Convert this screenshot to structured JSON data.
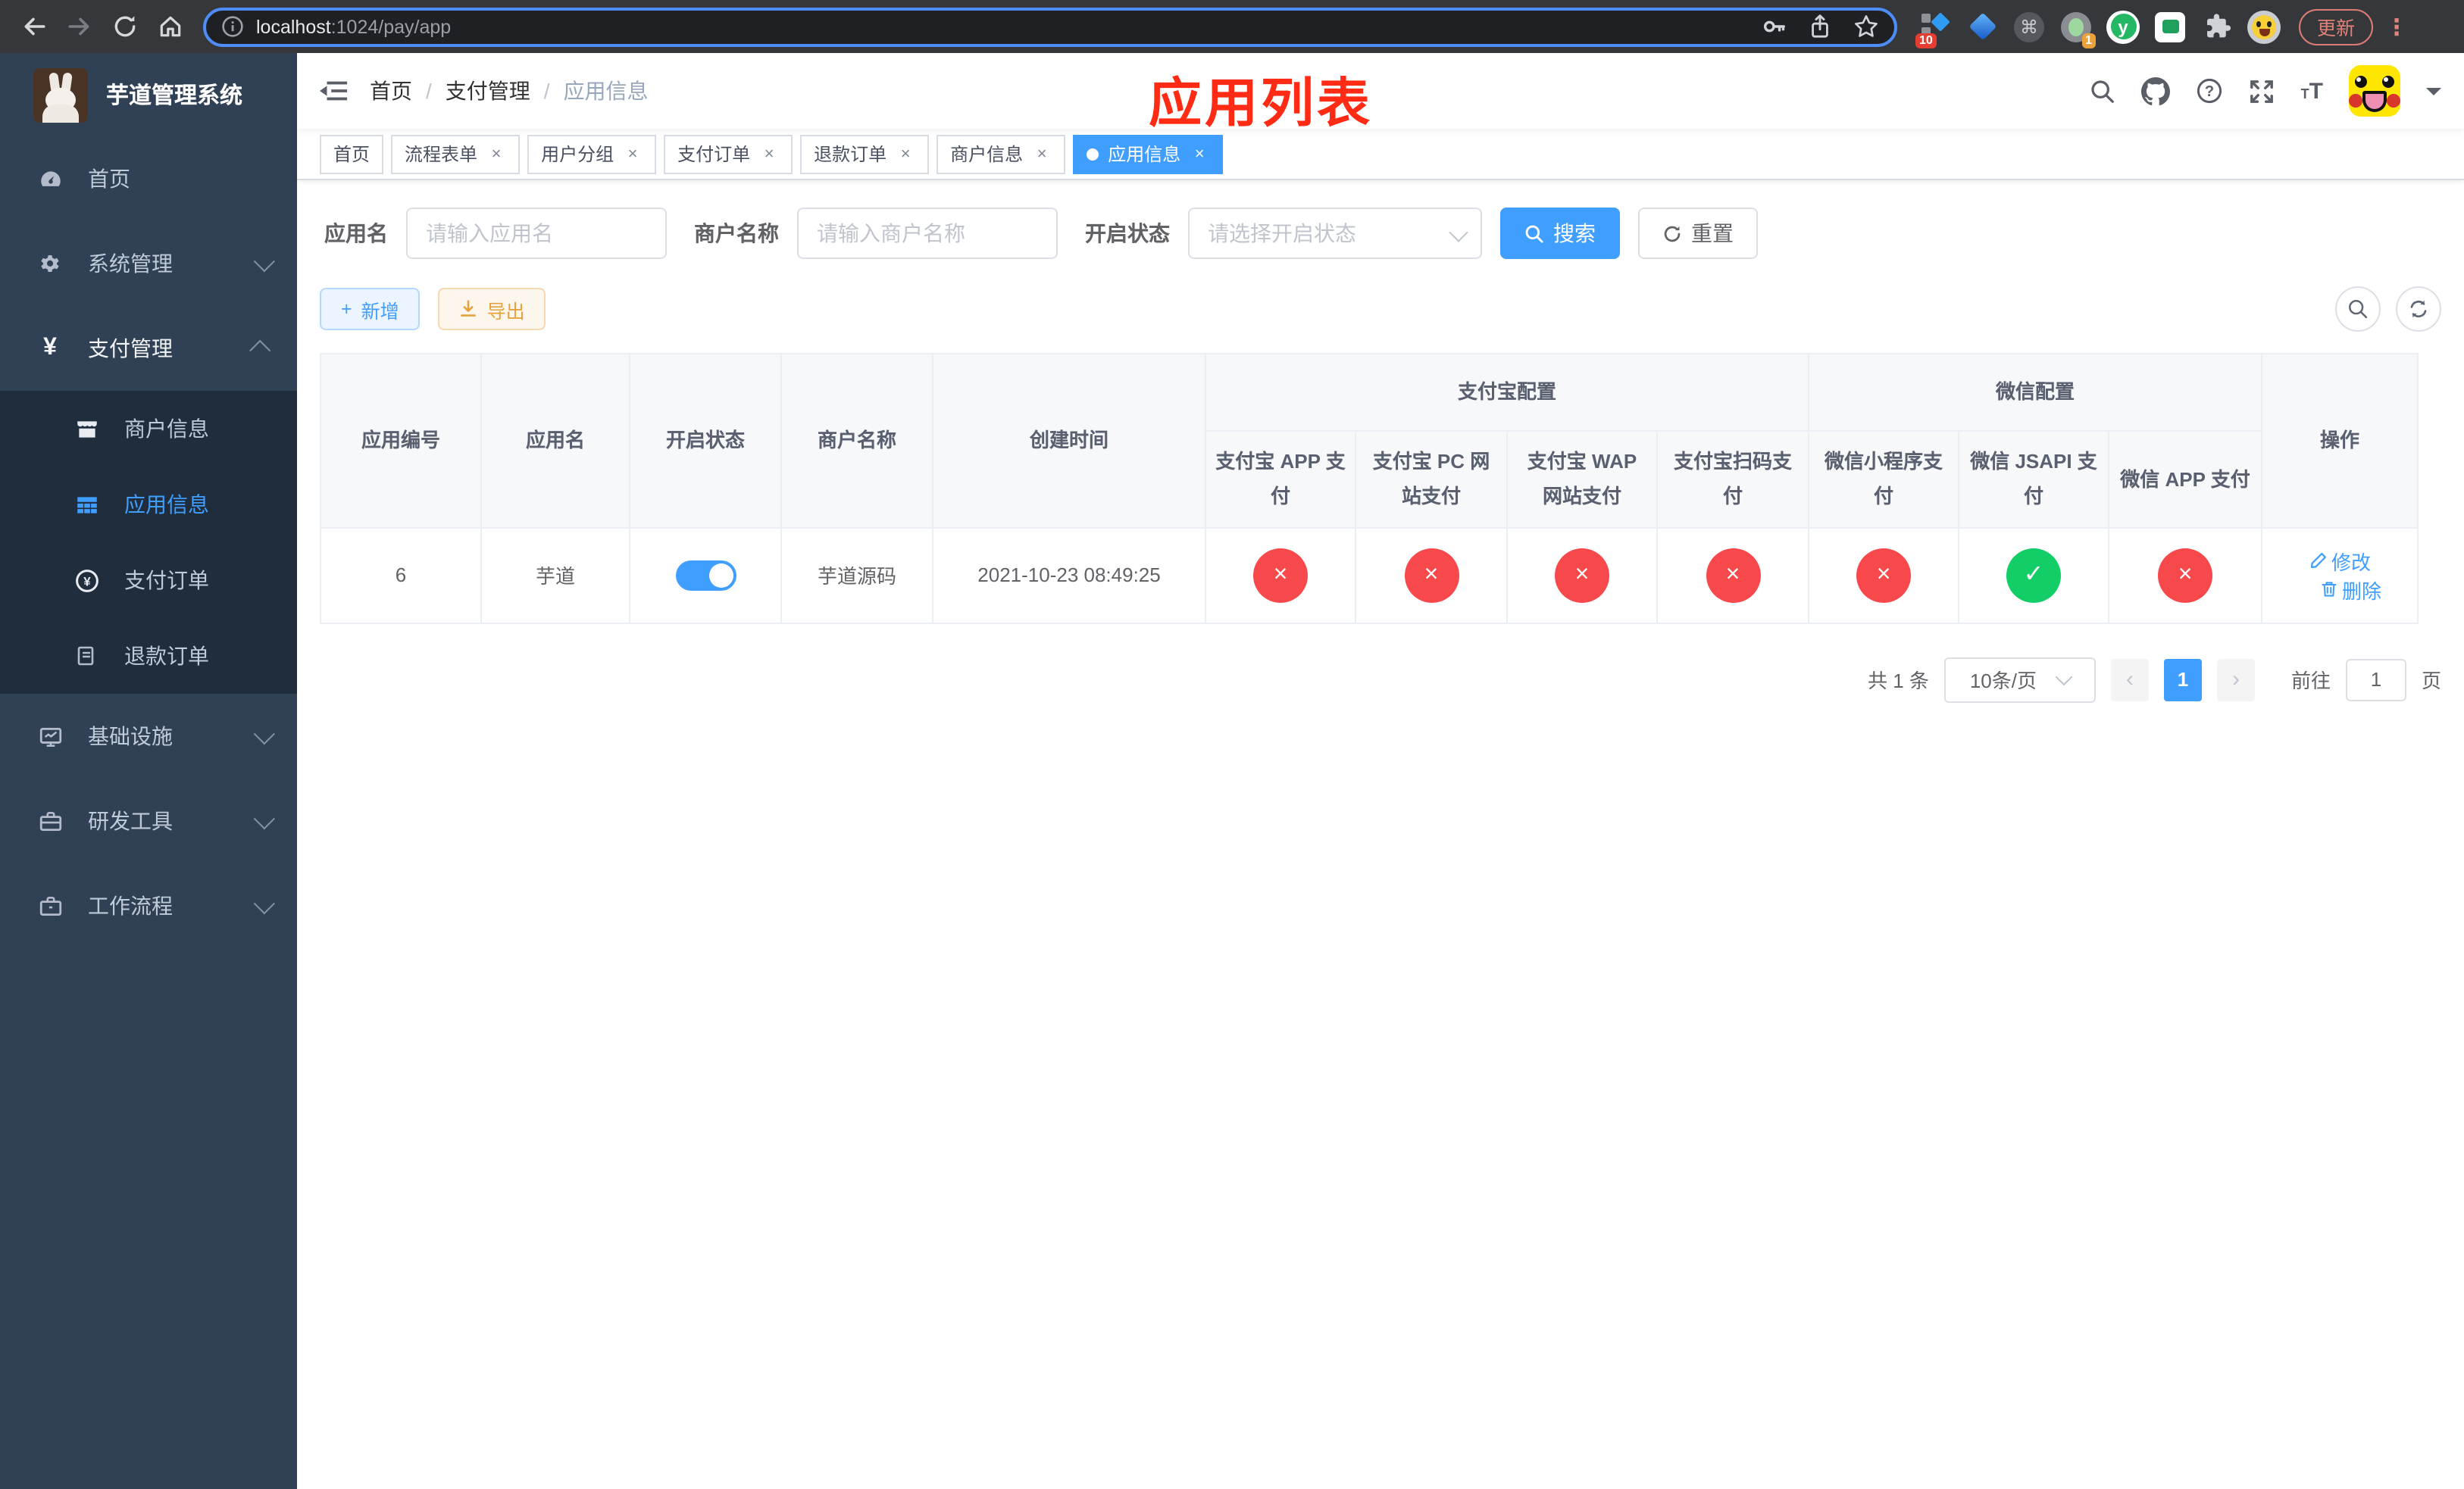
{
  "browser": {
    "url_host": "localhost",
    "url_path": ":1024/pay/app",
    "update_label": "更新",
    "menu_dots": "⋮",
    "ext_badge_blocks": "10",
    "ext_badge_record": "1",
    "ext_letter_y": "y",
    "cmd_glyph": "⌘"
  },
  "sidebar": {
    "title": "芋道管理系统",
    "items": {
      "home": "首页",
      "system": "系统管理",
      "payment": "支付管理",
      "merchant": "商户信息",
      "appinfo": "应用信息",
      "payorder": "支付订单",
      "refund": "退款订单",
      "infra": "基础设施",
      "devtools": "研发工具",
      "workflow": "工作流程"
    }
  },
  "header": {
    "breadcrumb": [
      "首页",
      "支付管理",
      "应用信息"
    ],
    "separator": "/",
    "annotation": "应用列表",
    "font_icon_small": "T",
    "font_icon_big": "T"
  },
  "tabs": {
    "items": [
      {
        "label": "首页"
      },
      {
        "label": "流程表单"
      },
      {
        "label": "用户分组"
      },
      {
        "label": "支付订单"
      },
      {
        "label": "退款订单"
      },
      {
        "label": "商户信息"
      },
      {
        "label": "应用信息"
      }
    ],
    "close_glyph": "×"
  },
  "filters": {
    "app_name_label": "应用名",
    "app_name_placeholder": "请输入应用名",
    "merchant_label": "商户名称",
    "merchant_placeholder": "请输入商户名称",
    "status_label": "开启状态",
    "status_placeholder": "请选择开启状态",
    "search_label": "搜索",
    "reset_label": "重置"
  },
  "toolbar": {
    "add_label": "新增",
    "add_plus": "+",
    "export_label": "导出"
  },
  "table": {
    "fixed_headers": [
      "应用编号",
      "应用名",
      "开启状态",
      "商户名称",
      "创建时间"
    ],
    "group_headers": [
      "支付宝配置",
      "微信配置"
    ],
    "sub_headers": [
      "支付宝 APP 支付",
      "支付宝 PC 网站支付",
      "支付宝 WAP 网站支付",
      "支付宝扫码支付",
      "微信小程序支付",
      "微信 JSAPI 支付",
      "微信 APP 支付"
    ],
    "ops_header": "操作",
    "ok_glyph": "✓",
    "fail_glyph": "×",
    "row": {
      "id": "6",
      "name": "芋道",
      "enabled": true,
      "merchant": "芋道源码",
      "created": "2021-10-23 08:49:25",
      "pay_statuses": [
        "fail",
        "fail",
        "fail",
        "fail",
        "fail",
        "ok",
        "fail"
      ],
      "edit_label": "修改",
      "delete_label": "删除"
    }
  },
  "pagination": {
    "total": "共 1 条",
    "page_size": "10条/页",
    "prev": "‹",
    "next": "›",
    "current": "1",
    "goto_label": "前往",
    "goto_value": "1",
    "page_unit": "页"
  },
  "colors": {
    "accent": "#409eff",
    "success": "#13ce66",
    "danger": "#f7494c",
    "warning": "#e6a23c",
    "annotation_red": "#ff2b14",
    "sidebar_bg": "#304156",
    "submenu_bg": "#1f2d3d"
  }
}
